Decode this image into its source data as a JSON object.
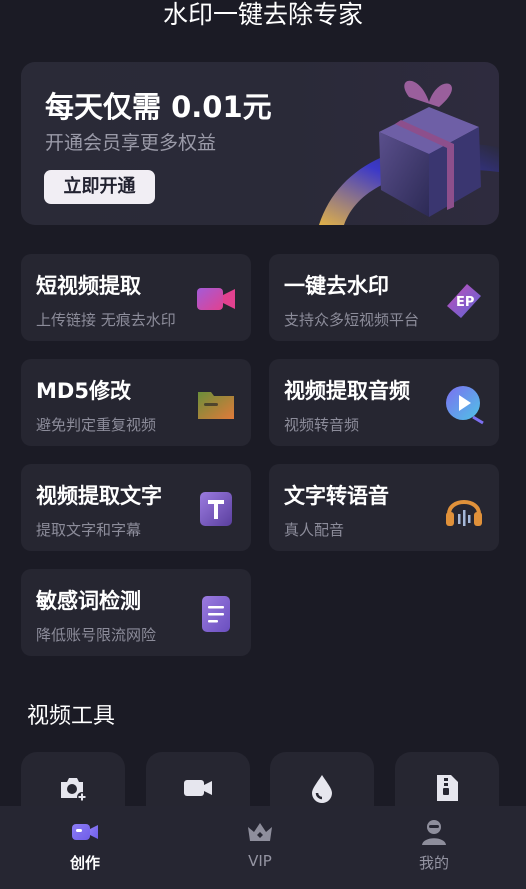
{
  "header": {
    "title": "水印一键去除专家"
  },
  "banner": {
    "title": "每天仅需 0.01元",
    "subtitle": "开通会员享更多权益",
    "button": "立即开通"
  },
  "features": [
    {
      "title": "短视频提取",
      "subtitle": "上传链接 无痕去水印",
      "icon": "video-camera-icon"
    },
    {
      "title": "一键去水印",
      "subtitle": "支持众多短视频平台",
      "icon": "eraser-icon"
    },
    {
      "title": "MD5修改",
      "subtitle": "避免判定重复视频",
      "icon": "folder-icon"
    },
    {
      "title": "视频提取音频",
      "subtitle": "视频转音频",
      "icon": "play-disc-icon"
    },
    {
      "title": "视频提取文字",
      "subtitle": "提取文字和字幕",
      "icon": "text-t-icon"
    },
    {
      "title": "文字转语音",
      "subtitle": "真人配音",
      "icon": "headphones-icon"
    },
    {
      "title": "敏感词检测",
      "subtitle": "降低账号限流网险",
      "icon": "document-lines-icon"
    }
  ],
  "section": {
    "title": "视频工具"
  },
  "tabs": [
    {
      "label": "创作",
      "icon": "video-camera-icon",
      "active": true
    },
    {
      "label": "VIP",
      "icon": "crown-icon",
      "active": false
    },
    {
      "label": "我的",
      "icon": "user-icon",
      "active": false
    }
  ],
  "colors": {
    "background": "#1b1b25",
    "card": "#262631",
    "accent_purple": "#8b5cf6"
  }
}
